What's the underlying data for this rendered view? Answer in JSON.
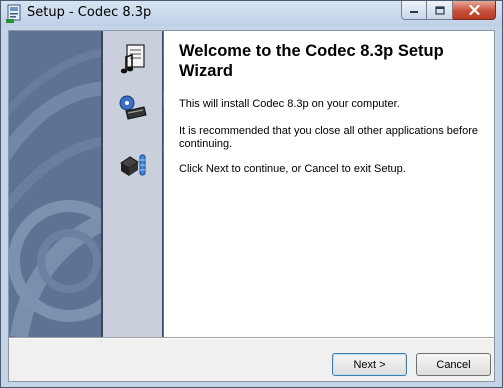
{
  "window": {
    "title": "Setup - Codec 8.3p",
    "controls": {
      "minimize_icon": "minimize-icon",
      "maximize_icon": "maximize-icon",
      "close_icon": "close-icon"
    }
  },
  "banner": {
    "icons": [
      "music-document-icon",
      "cd-drive-icon",
      "install-box-icon"
    ]
  },
  "main": {
    "heading": "Welcome to the Codec 8.3p Setup Wizard",
    "paragraphs": [
      "This will install Codec 8.3p on your computer.",
      "It is recommended that you close all other applications before continuing.",
      "Click Next to continue, or Cancel to exit Setup."
    ]
  },
  "buttons": {
    "next_label": "Next >",
    "cancel_label": "Cancel"
  },
  "colors": {
    "titlebar": "#c4d3e6",
    "banner": "#5a6f8f",
    "close_button": "#c8503b"
  }
}
